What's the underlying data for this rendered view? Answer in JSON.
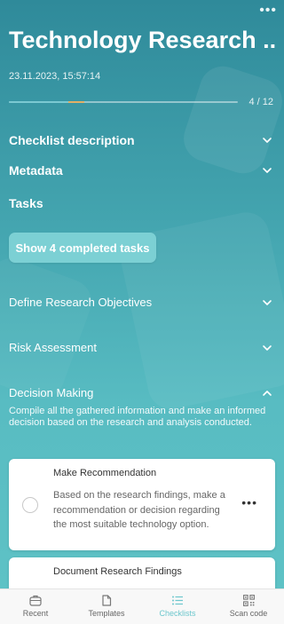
{
  "header": {
    "title": "Technology Research ...",
    "datetime": "23.11.2023, 15:57:14",
    "more_icon": "ellipsis-icon"
  },
  "progress": {
    "label": "4 / 12",
    "fraction": 0.33,
    "accent_segment_start": 0.26,
    "accent_segment_end": 0.33,
    "track_color": "#7bc9d2",
    "accent_color": "#e2b066"
  },
  "sections": {
    "checklist_description": "Checklist description",
    "metadata": "Metadata",
    "tasks": "Tasks"
  },
  "show_completed_button": "Show 4 completed tasks",
  "groups": {
    "define_objectives": "Define Research Objectives",
    "risk_assessment": "Risk Assessment",
    "decision_making": "Decision Making",
    "decision_making_description": "Compile all the gathered information and make an informed decision based on the research and analysis conducted."
  },
  "tasks": [
    {
      "title": "Make Recommendation",
      "description": "Based on the research findings, make a recommendation or decision regarding the most suitable technology option."
    },
    {
      "title": "Document Research Findings"
    }
  ],
  "tabbar": {
    "items": [
      {
        "label": "Recent",
        "icon": "briefcase-icon"
      },
      {
        "label": "Templates",
        "icon": "document-icon"
      },
      {
        "label": "Checklists",
        "icon": "list-icon",
        "active": true
      },
      {
        "label": "Scan code",
        "icon": "qr-code-icon"
      }
    ],
    "active_color": "#6cc7cd"
  }
}
